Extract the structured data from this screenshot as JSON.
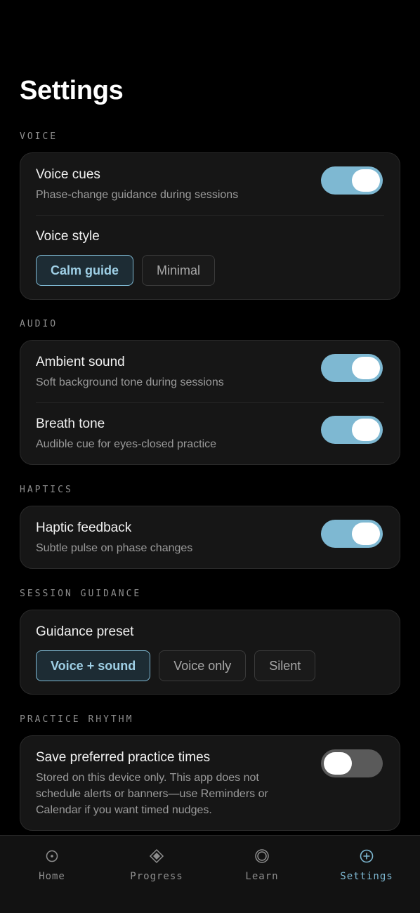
{
  "page": {
    "title": "Settings"
  },
  "sections": {
    "voice": {
      "label": "VOICE",
      "voice_cues": {
        "title": "Voice cues",
        "subtitle": "Phase-change guidance during sessions",
        "enabled": true
      },
      "voice_style": {
        "title": "Voice style",
        "options": [
          "Calm guide",
          "Minimal"
        ],
        "selected": "Calm guide"
      }
    },
    "audio": {
      "label": "AUDIO",
      "ambient": {
        "title": "Ambient sound",
        "subtitle": "Soft background tone during sessions",
        "enabled": true
      },
      "breath": {
        "title": "Breath tone",
        "subtitle": "Audible cue for eyes-closed practice",
        "enabled": true
      }
    },
    "haptics": {
      "label": "HAPTICS",
      "feedback": {
        "title": "Haptic feedback",
        "subtitle": "Subtle pulse on phase changes",
        "enabled": true
      }
    },
    "guidance": {
      "label": "SESSION GUIDANCE",
      "preset": {
        "title": "Guidance preset",
        "options": [
          "Voice + sound",
          "Voice only",
          "Silent"
        ],
        "selected": "Voice + sound"
      }
    },
    "rhythm": {
      "label": "PRACTICE RHYTHM",
      "save_times": {
        "title": "Save preferred practice times",
        "subtitle_lines": [
          "Stored on this device only. This app does not",
          "schedule alerts or banners—use Reminders or",
          "Calendar if you want timed nudges."
        ],
        "enabled": false
      }
    }
  },
  "tabbar": {
    "tabs": [
      {
        "label": "Home",
        "icon": "home-icon"
      },
      {
        "label": "Progress",
        "icon": "progress-icon"
      },
      {
        "label": "Learn",
        "icon": "learn-icon"
      },
      {
        "label": "Settings",
        "icon": "settings-icon"
      }
    ],
    "active": "Settings"
  },
  "colors": {
    "accent": "#7eb8d2",
    "background": "#000000",
    "card": "#161616",
    "toggle_off": "#5a5a5a"
  }
}
